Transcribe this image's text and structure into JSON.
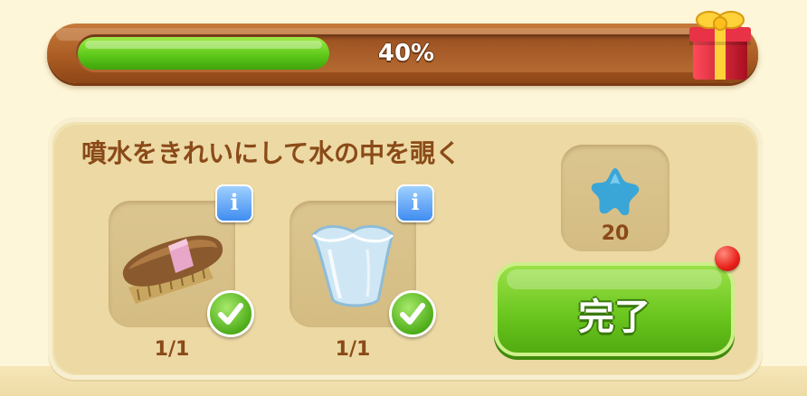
{
  "progress": {
    "label": "40%",
    "value": 0.4,
    "fill_color": "#5ec91a"
  },
  "reward_box": {
    "icon": "gift-box-icon"
  },
  "task": {
    "title": "噴水をきれいにして水の中を覗く",
    "items": [
      {
        "icon": "brush-icon",
        "count": "1/1",
        "completed": true,
        "info": "i"
      },
      {
        "icon": "glass-vase-icon",
        "count": "1/1",
        "completed": true,
        "info": "i"
      }
    ]
  },
  "reward": {
    "icon": "blue-star-icon",
    "amount": "20"
  },
  "complete_button": {
    "label": "完了",
    "color": "#6cc71f",
    "has_notification": true
  }
}
